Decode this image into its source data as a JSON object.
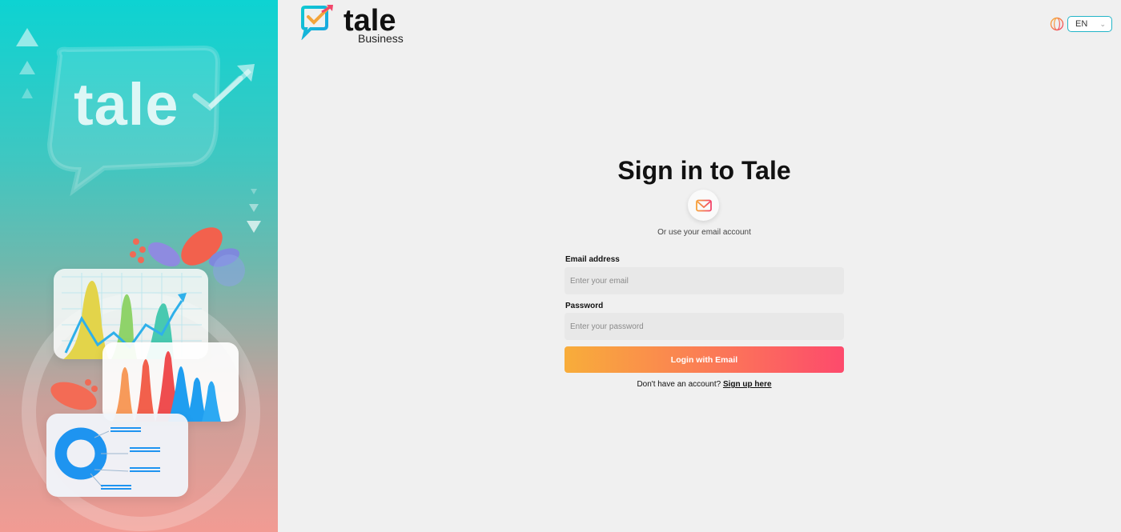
{
  "brand": {
    "logo_word": "tale",
    "logo_sub": "Business",
    "illustration_word": "tale"
  },
  "language": {
    "selected": "EN"
  },
  "signin": {
    "title": "Sign in to Tale",
    "or_text": "Or use your email account",
    "email_label": "Email address",
    "email_placeholder": "Enter your email",
    "email_value": "",
    "password_label": "Password",
    "password_placeholder": "Enter your password",
    "password_value": "",
    "login_button": "Login with Email",
    "no_account_text": "Don't have an account?",
    "signup_link": "Sign up here"
  },
  "colors": {
    "accent_teal": "#0dd3d2",
    "button_start": "#f8ad3a",
    "button_end": "#fd4a6c",
    "input_bg": "#e8e8e8",
    "page_bg": "#f0f0f0"
  },
  "icons": [
    "globe-icon",
    "chevron-down-icon",
    "mail-icon",
    "logo-check-icon"
  ]
}
